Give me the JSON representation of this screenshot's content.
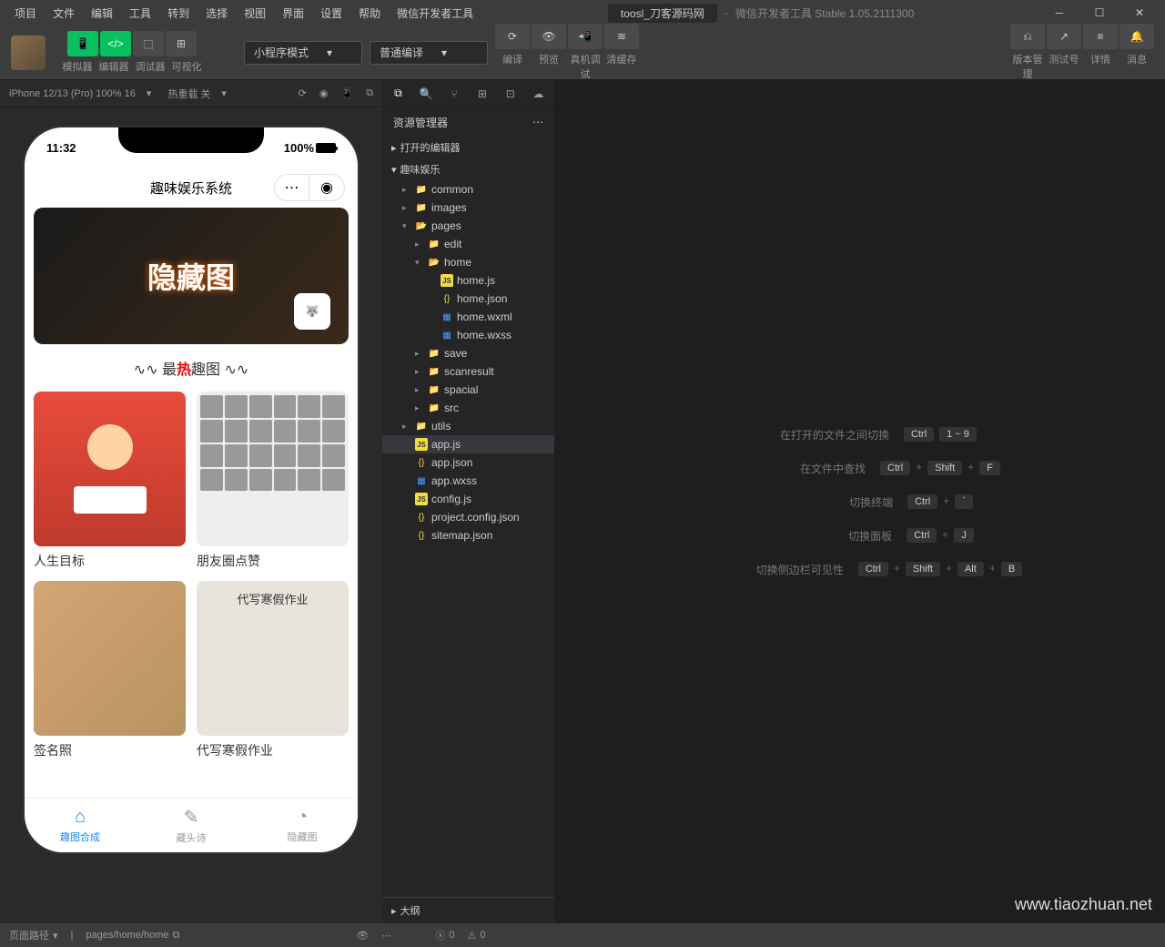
{
  "menu": [
    "项目",
    "文件",
    "编辑",
    "工具",
    "转到",
    "选择",
    "视图",
    "界面",
    "设置",
    "帮助",
    "微信开发者工具"
  ],
  "title": {
    "project": "toosl_刀客源码网",
    "app": "微信开发者工具 Stable 1.05.2111300"
  },
  "toolbar": {
    "labels": {
      "sim": "模拟器",
      "editor": "编辑器",
      "debug": "调试器",
      "visual": "可视化"
    },
    "mode": "小程序模式",
    "compile": "普通编译",
    "actions": {
      "compile": "编译",
      "preview": "预览",
      "realdev": "真机调试",
      "clearcache": "清缓存"
    },
    "right": {
      "version": "版本管理",
      "test": "测试号",
      "detail": "详情",
      "msg": "消息"
    }
  },
  "sim": {
    "device": "iPhone 12/13 (Pro) 100% 16",
    "hotreload": "热重载 关"
  },
  "phone": {
    "time": "11:32",
    "battery": "100%",
    "title": "趣味娱乐系统",
    "banner": "隐藏图",
    "section": {
      "pre": "最",
      "hot": "热",
      "post": "趣图"
    },
    "cards": [
      "人生目标",
      "朋友圈点赞",
      "签名照",
      "代写寒假作业"
    ],
    "card4_title": "代写寒假作业",
    "tabs": [
      "趣图合成",
      "藏头诗",
      "隐藏图"
    ]
  },
  "explorer": {
    "title": "资源管理器",
    "open_editors": "打开的编辑器",
    "project": "趣味娱乐",
    "outline": "大纲",
    "tree": {
      "common": "common",
      "images": "images",
      "pages": "pages",
      "edit": "edit",
      "home": "home",
      "homejs": "home.js",
      "homejson": "home.json",
      "homewxml": "home.wxml",
      "homewxss": "home.wxss",
      "save": "save",
      "scanresult": "scanresult",
      "spacial": "spacial",
      "src": "src",
      "utils": "utils",
      "appjs": "app.js",
      "appjson": "app.json",
      "appwxss": "app.wxss",
      "configjs": "config.js",
      "projectconfig": "project.config.json",
      "sitemap": "sitemap.json"
    }
  },
  "shortcuts": [
    {
      "label": "在打开的文件之间切换",
      "keys": [
        "Ctrl",
        "1 ~ 9"
      ]
    },
    {
      "label": "在文件中查找",
      "keys": [
        "Ctrl",
        "+",
        "Shift",
        "+",
        "F"
      ]
    },
    {
      "label": "切换终端",
      "keys": [
        "Ctrl",
        "+",
        "`"
      ]
    },
    {
      "label": "切换面板",
      "keys": [
        "Ctrl",
        "+",
        "J"
      ]
    },
    {
      "label": "切换侧边栏可见性",
      "keys": [
        "Ctrl",
        "+",
        "Shift",
        "+",
        "Alt",
        "+",
        "B"
      ]
    }
  ],
  "statusbar": {
    "pagepath": "页面路径",
    "path": "pages/home/home",
    "errors": "0",
    "warnings": "0"
  },
  "watermark": "www.tiaozhuan.net"
}
